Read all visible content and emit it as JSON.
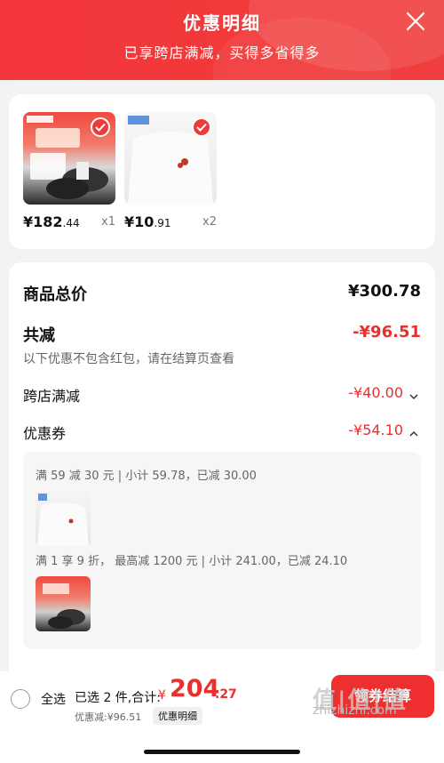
{
  "header": {
    "title": "优惠明细",
    "subtitle": "已享跨店满减，买得多省得多"
  },
  "products": [
    {
      "price_int": "¥182",
      "price_dec": ".44",
      "qty": "x1"
    },
    {
      "price_int": "¥10",
      "price_dec": ".91",
      "qty": "x2"
    }
  ],
  "summary": {
    "total_label": "商品总价",
    "total_value": "¥300.78",
    "reduce_label": "共减",
    "reduce_value": "-¥96.51",
    "note": "以下优惠不包含红包，请在结算页查看",
    "cross_store_label": "跨店满减",
    "cross_store_value": "-¥40.00",
    "coupon_label": "优惠券",
    "coupon_value": "-¥54.10"
  },
  "coupon_details": [
    {
      "rule": "满 59 减 30 元 | 小计 59.78，已减 30.00"
    },
    {
      "rule": "满 1 享 9 折， 最高减 1200 元 | 小计 241.00，已减 24.10"
    }
  ],
  "footer": {
    "select_all": "全选",
    "selected_info": "已选 2 件,合计:",
    "total_yen": "¥",
    "total_int": "204",
    "total_dec": ".27",
    "discount": "优惠减:¥96.51",
    "detail_button": "优惠明细",
    "checkout": "领券结算",
    "watermark_logo": "值|值|值",
    "watermark": "zhizhizhi.com"
  },
  "colors": {
    "accent": "#e8312f",
    "header_bg": "#f2353a"
  }
}
